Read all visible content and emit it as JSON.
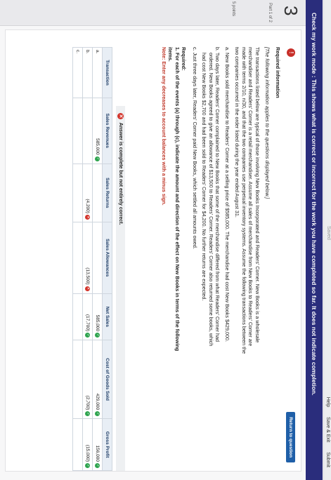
{
  "header": {
    "brand": "Saved",
    "links": [
      "Help",
      "Save & Exit",
      "Submit"
    ]
  },
  "banner": "Check my work mode : This shows what is correct or incorrect for the work you have completed so far. It does not indicate completion.",
  "rail": {
    "question_number": "3",
    "part": "Part 1 of 2",
    "points": "5 points"
  },
  "return_button": "Return to question",
  "info": {
    "heading": "Required information",
    "intro": "[The following information applies to the questions displayed below.]",
    "paragraph": "The transactions listed below are typical of those involving New Books Incorporated and Readers' Corner. New Books is a wholesale merchandiser and Readers' Corner is a retail merchandiser. Assume all sales of merchandise from New Books to Readers' Corner are made with terms 2/10, n/30, and that the two companies use perpetual inventory systems. Assume the following transactions between the two companies occurred in the order listed during the year ended August 31.",
    "items": [
      "a. New Books sold merchandise to Readers' Corner at a selling price of $585,000. The merchandise had cost New Books $429,000.",
      "b. Two days later, Readers' Corner complained to New Books that some of the merchandise differed from what Readers' Corner had ordered. New Books agreed to give an allowance of $13,500 to Readers' Corner. Readers' Corner also returned some books, which had cost New Books $2,700 and had been sold to Readers' Corner for $4,200. No further returns are expected.",
      "c. Just three days later, Readers' Corner paid New Books, which settled all amounts owed."
    ],
    "required_heading": "Required:",
    "required_text": "1. For each of the events (a) through (c), indicate the amount and direction of the effect on New Books in terms of the following items.",
    "note": "Note: Enter any decreases to account balances with a minus sign."
  },
  "answer_banner": "Answer is complete but not entirely correct.",
  "table": {
    "headers": [
      "Transaction",
      "Sales Revenues",
      "Sales Returns",
      "Sales Allowances",
      "Net Sales",
      "Cost of Goods Sold",
      "Gross Profit"
    ],
    "rows": [
      {
        "label": "a.",
        "cells": [
          {
            "v": "585,000",
            "s": "ok"
          },
          {
            "v": "",
            "s": ""
          },
          {
            "v": "",
            "s": ""
          },
          {
            "v": "585,000",
            "s": "ok"
          },
          {
            "v": "429,000",
            "s": "ok"
          },
          {
            "v": "156,000",
            "s": "ok"
          }
        ]
      },
      {
        "label": "b.",
        "cells": [
          {
            "v": "",
            "s": ""
          },
          {
            "v": "(4,200)",
            "s": "bad"
          },
          {
            "v": "(13,500)",
            "s": "bad"
          },
          {
            "v": "(17,700)",
            "s": "ok"
          },
          {
            "v": "(2,700)",
            "s": "ok"
          },
          {
            "v": "(15,000)",
            "s": "ok"
          }
        ]
      },
      {
        "label": "c.",
        "cells": [
          {
            "v": "",
            "s": ""
          },
          {
            "v": "",
            "s": ""
          },
          {
            "v": "",
            "s": ""
          },
          {
            "v": "",
            "s": ""
          },
          {
            "v": "",
            "s": ""
          },
          {
            "v": "",
            "s": ""
          }
        ]
      }
    ]
  }
}
